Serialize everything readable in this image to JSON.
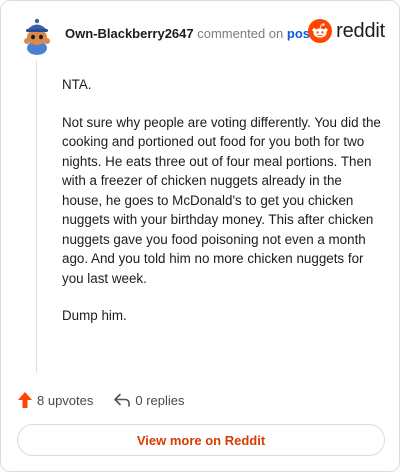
{
  "header": {
    "username": "Own-Blackberry2647",
    "action_text": "commented on",
    "post_link": "post",
    "brand_text": "reddit"
  },
  "comment": {
    "paragraphs": [
      "NTA.",
      "Not sure why people are voting differently. You did the cooking and portioned out food for you both for two nights. He eats three out of four meal portions. Then with a freezer of chicken nuggets already in the house, he goes to McDonald's to get you chicken nuggets with your birthday money. This after chicken nuggets gave you food poisoning not even a month ago. And you told him no more chicken nuggets for you last week.",
      "Dump him."
    ]
  },
  "actions": {
    "upvotes": "8 upvotes",
    "replies": "0 replies"
  },
  "footer": {
    "view_more": "View more on Reddit"
  },
  "colors": {
    "upvote_arrow": "#ff4500",
    "view_more_text": "#d93a00",
    "post_link": "#0b5ed7",
    "brand": "#ff4500"
  },
  "icons": {
    "avatar": "snoo-avatar-blue-beanie",
    "logo": "reddit-snoo-logo",
    "upvote": "upvote-arrow-icon",
    "reply": "reply-arrow-icon"
  }
}
